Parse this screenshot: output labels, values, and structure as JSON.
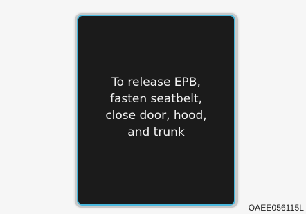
{
  "display": {
    "message_lines": [
      "To release EPB,",
      "fasten seatbelt,",
      "close door, hood,",
      "and trunk"
    ]
  },
  "figure_code": "OAEE056115L",
  "colors": {
    "screen_background": "#1b1b1b",
    "screen_border": "#49b7dc",
    "text": "#f2f2f2",
    "page_background": "#f6f6f6"
  }
}
